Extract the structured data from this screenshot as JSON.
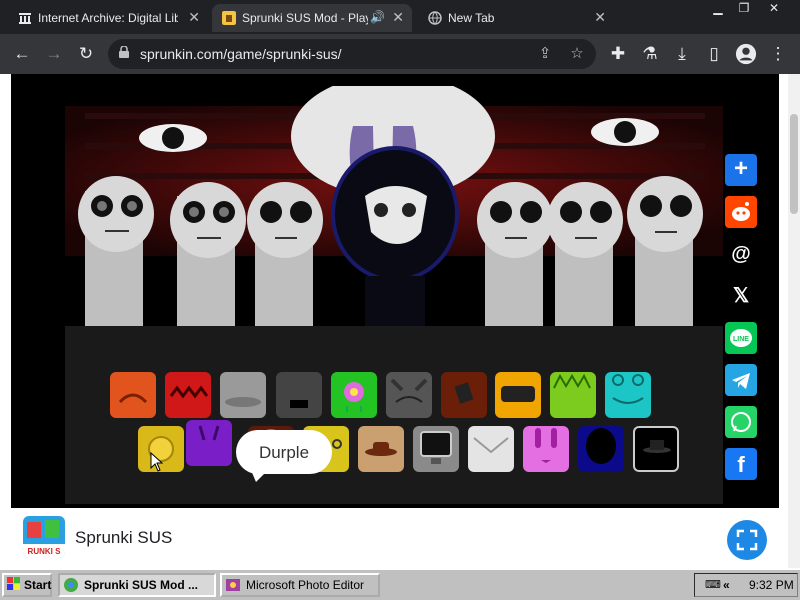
{
  "browser": {
    "tabs": [
      {
        "title": "Internet Archive: Digital Libr",
        "active": false
      },
      {
        "title": "Sprunki SUS Mod - Play",
        "active": true
      },
      {
        "title": "New Tab",
        "active": false
      }
    ],
    "address": "sprunkin.com/game/sprunki-sus/"
  },
  "game": {
    "tooltip": "Durple",
    "characters_row1": [
      "orange-frown",
      "red-teeth",
      "gray-hat",
      "black-tv",
      "green-flower",
      "gray-cat-ears",
      "brown-cup",
      "yellow-goggles",
      "lime-spiky",
      "cyan-frog"
    ],
    "characters_row2": [
      "yellow-sun",
      "purple-horns",
      "brown-tree",
      "yellow-antennae",
      "tan-hat",
      "gray-monitor",
      "white-envelope",
      "pink-bunny",
      "blue-black-head",
      "black-tophat"
    ]
  },
  "share": [
    "share-plus-icon",
    "reddit-icon",
    "threads-icon",
    "x-icon",
    "line-icon",
    "telegram-icon",
    "whatsapp-icon",
    "facebook-icon"
  ],
  "app": {
    "name": "Sprunki SUS",
    "logo_text": "RUNKI S"
  },
  "taskbar": {
    "start": "Start",
    "items": [
      "Sprunki SUS Mod ...",
      "Microsoft Photo Editor"
    ],
    "clock": "9:32 PM"
  }
}
